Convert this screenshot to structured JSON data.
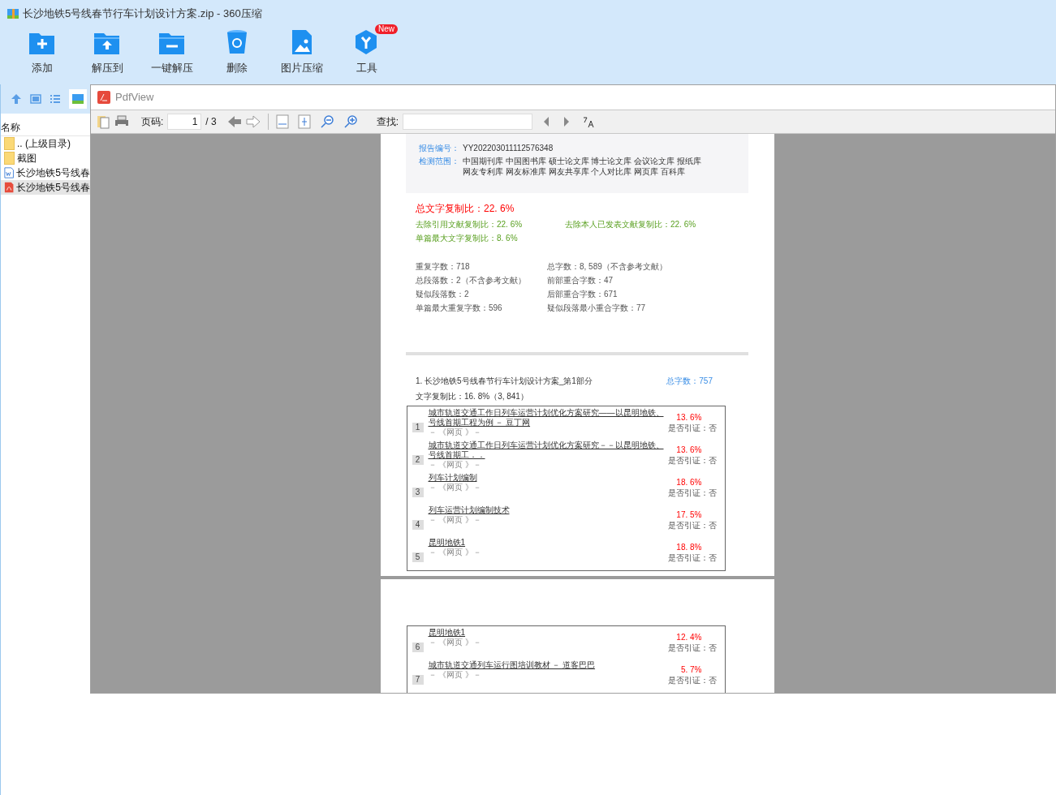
{
  "window": {
    "title": "长沙地铁5号线春节行车计划设计方案.zip - 360压缩"
  },
  "toolbar": [
    {
      "label": "添加",
      "kind": "add"
    },
    {
      "label": "解压到",
      "kind": "extract"
    },
    {
      "label": "一键解压",
      "kind": "oneclick"
    },
    {
      "label": "删除",
      "kind": "delete"
    },
    {
      "label": "图片压缩",
      "kind": "image"
    },
    {
      "label": "工具",
      "kind": "tools",
      "badge": "New"
    }
  ],
  "file_list": {
    "header": "名称",
    "items": [
      {
        "name": ".. (上级目录)",
        "kind": "folder",
        "selected": false
      },
      {
        "name": "截图",
        "kind": "folder",
        "selected": false
      },
      {
        "name": "长沙地铁5号线春",
        "kind": "word",
        "selected": false
      },
      {
        "name": "长沙地铁5号线春",
        "kind": "pdf",
        "selected": true
      }
    ]
  },
  "pdf_viewer": {
    "title": "PdfView",
    "page_label": "页码:",
    "page": "1",
    "page_total": "/ 3",
    "find_label": "查找:"
  },
  "report": {
    "info": [
      {
        "label": "报告编号：",
        "lines": [
          "YY202203011112576348"
        ]
      },
      {
        "label": "检测范围：",
        "lines": [
          "中国期刊库  中国图书库  硕士论文库  博士论文库  会议论文库  报纸库",
          "网友专利库  网友标准库  网友共享库  个人对比库  网页库  百科库"
        ]
      }
    ],
    "total_ratio": "总文字复制比：22. 6%",
    "ratios": [
      "去除引用文献复制比：22. 6%",
      "去除本人已发表文献复制比：22. 6%",
      "单篇最大文字复制比：8. 6%"
    ],
    "stats": [
      "重复字数：718",
      "总字数：8, 589（不含参考文献）",
      "总段落数：2（不含参考文献）",
      "前部重合字数：47",
      "疑似段落数：2",
      "后部重合字数：671",
      "单篇最大重复字数：596",
      "疑似段落最小重合字数：77"
    ],
    "section_title": "1. 长沙地铁5号线春节行车计划设计方案_第1部分",
    "section_count": "总字数：757",
    "section_ratio": "文字复制比：16. 8%（3, 841）",
    "sources_page1": [
      {
        "num": "1",
        "title": "城市轨道交通工作日列车运营计划优化方案研究——以昆明地铁、号线首期工程为例 － 豆丁网",
        "source": "－ 《网页 》－",
        "percent": "13. 6%",
        "cited": "是否引证：否"
      },
      {
        "num": "2",
        "title": "城市轨道交通工作日列车运营计划优化方案研究－－以昆明地铁、号线首期工．．",
        "source": "－ 《网页 》－",
        "percent": "13. 6%",
        "cited": "是否引证：否"
      },
      {
        "num": "3",
        "title": "列车计划编制",
        "source": "－ 《网页 》－",
        "percent": "18. 6%",
        "cited": "是否引证：否"
      },
      {
        "num": "4",
        "title": "列车运营计划编制技术",
        "source": "－ 《网页 》－",
        "percent": "17. 5%",
        "cited": "是否引证：否"
      },
      {
        "num": "5",
        "title": "昆明地铁1",
        "source": "－ 《网页 》－",
        "percent": "18. 8%",
        "cited": "是否引证：否"
      }
    ],
    "sources_page2": [
      {
        "num": "6",
        "title": "昆明地铁1",
        "source": "－ 《网页 》－",
        "percent": "12. 4%",
        "cited": "是否引证：否"
      },
      {
        "num": "7",
        "title": "城市轨道交通列车运行图培训教材 － 道客巴巴",
        "source": "－ 《网页 》－",
        "percent": "5. 7%",
        "cited": "是否引证：否"
      }
    ]
  }
}
